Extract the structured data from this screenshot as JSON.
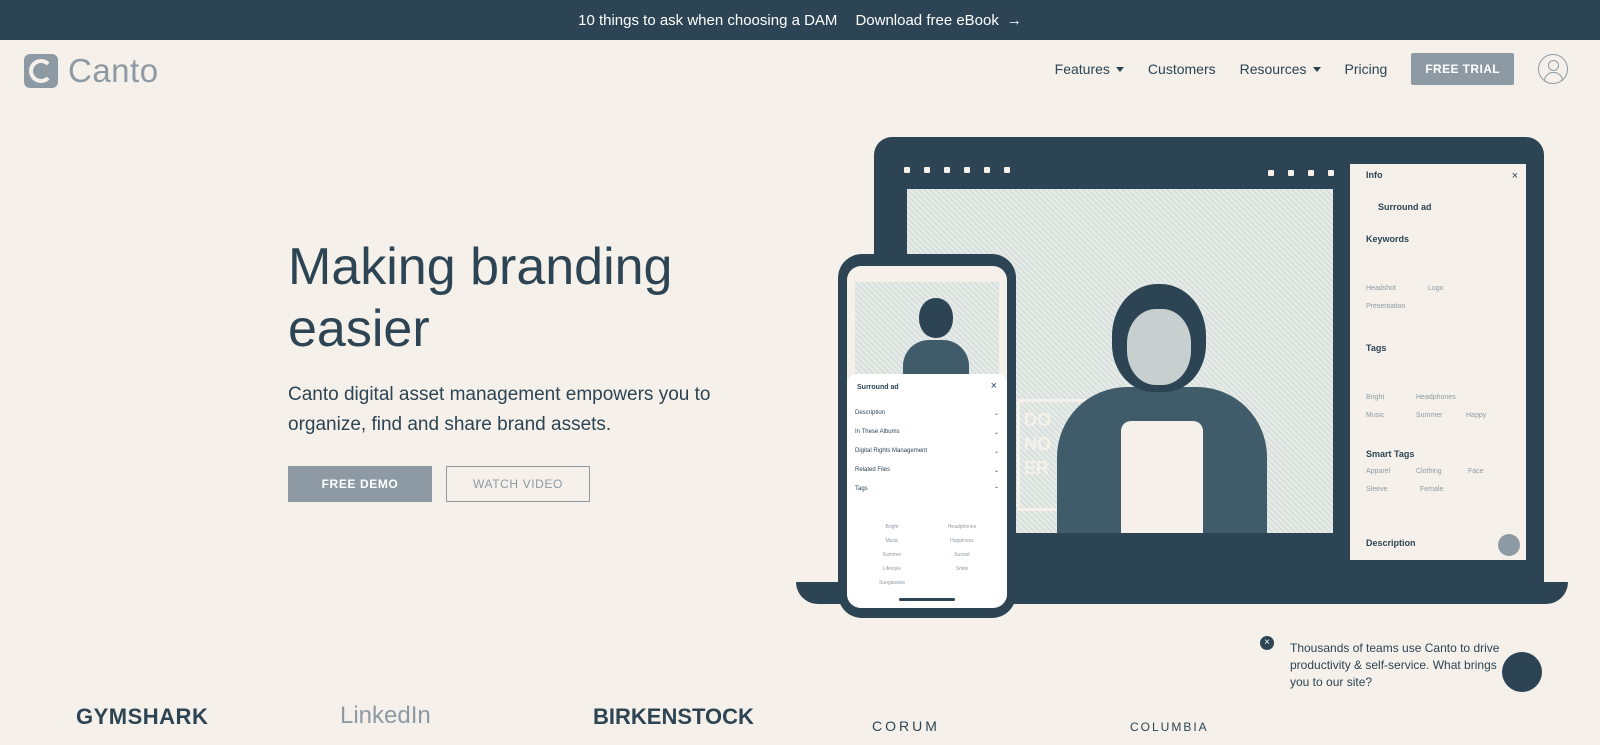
{
  "banner": {
    "text": "10 things to ask when choosing a DAM",
    "link": "Download free eBook",
    "arrow": "→"
  },
  "header": {
    "brand": "Canto",
    "nav": {
      "features": "Features",
      "customers": "Customers",
      "resources": "Resources",
      "pricing": "Pricing"
    },
    "trial_label": "FREE TRIAL"
  },
  "hero": {
    "title": "Making branding easier",
    "subtitle": "Canto digital asset management empowers you to organize, find and share brand assets.",
    "demo_label": "FREE DEMO",
    "video_label": "WATCH VIDEO"
  },
  "laptop_panel": {
    "title": "Info",
    "asset_name": "Surround ad",
    "keywords_label": "Keywords",
    "tags_label": "Tags",
    "smart_tags_label": "Smart Tags",
    "description_label": "Description",
    "keyword_chips": [
      "Headshot",
      "Logo",
      "Presentation"
    ],
    "tag_chips": [
      "Bright",
      "Headphones",
      "Music",
      "Summer",
      "Happy"
    ],
    "smart_tag_chips": [
      "Apparel",
      "Clothing",
      "Face",
      "Sleeve",
      "Female"
    ],
    "photo_sign": "DO NO ER"
  },
  "phone_panel": {
    "title": "Surround ad",
    "rows": [
      "Description",
      "In These Albums",
      "Digital Rights Management",
      "Related Files",
      "Tags"
    ],
    "tags": [
      "Bright",
      "Headphones",
      "Music",
      "Happiness",
      "Summer",
      "Sunset",
      "Lifestyle",
      "Smile",
      "Sunglasses"
    ]
  },
  "customers": {
    "logos": [
      "GYMSHARK",
      "LinkedIn",
      "BIRKENSTOCK",
      "CORUM",
      "COLUMBIA"
    ]
  },
  "chat": {
    "message": "Thousands of teams use Canto to drive productivity & self-service. What brings you to our site?",
    "close": "×"
  },
  "colors": {
    "navy": "#2c4453",
    "gray": "#8e9aa3",
    "cream": "#f5f1ea"
  }
}
